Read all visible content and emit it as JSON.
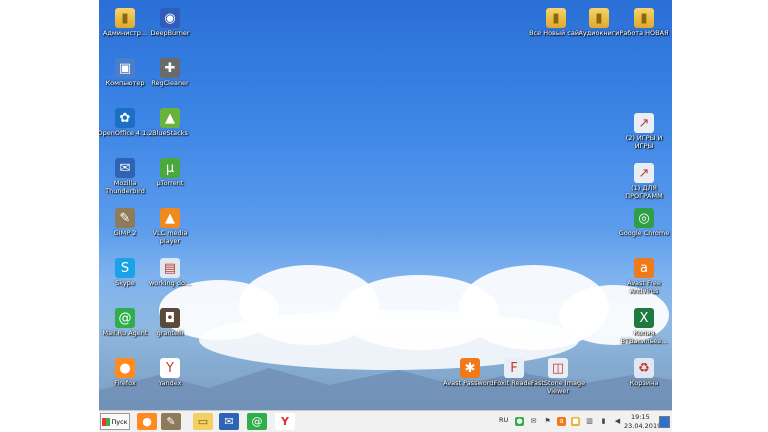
{
  "desktop": {
    "left_icons": [
      {
        "label": "Администр...",
        "icon": "user-folder-icon"
      },
      {
        "label": "DeepBurner",
        "icon": "deepburner-icon"
      },
      {
        "label": "Компьютер",
        "icon": "computer-icon"
      },
      {
        "label": "RegCleaner",
        "icon": "regcleaner-icon"
      },
      {
        "label": "OpenOffice 4.1.2",
        "icon": "openoffice-icon"
      },
      {
        "label": "BlueStacks",
        "icon": "bluestacks-icon"
      },
      {
        "label": "Mozilla Thunderbird",
        "icon": "thunderbird-icon"
      },
      {
        "label": "µTorrent",
        "icon": "utorrent-icon"
      },
      {
        "label": "GIMP 2",
        "icon": "gimp-icon"
      },
      {
        "label": "VLC media player",
        "icon": "vlc-icon"
      },
      {
        "label": "Skype",
        "icon": "skype-icon"
      },
      {
        "label": "working do...",
        "icon": "document-icon"
      },
      {
        "label": "Mail.Ru Agent",
        "icon": "mailru-agent-icon"
      },
      {
        "label": "grantelli",
        "icon": "grantelli-icon"
      },
      {
        "label": "Firefox",
        "icon": "firefox-icon"
      },
      {
        "label": "Yandex",
        "icon": "yandex-browser-icon"
      }
    ],
    "right_icons": [
      {
        "label": "Все Новый сайт",
        "icon": "folder-icon"
      },
      {
        "label": "Аудиокниги",
        "icon": "folder-icon"
      },
      {
        "label": "Работа НОВАЯ",
        "icon": "folder-icon"
      },
      {
        "label": "(2) ИГРЫ И ИГРЫ",
        "icon": "shortcut-icon"
      },
      {
        "label": "(1) ДЛЯ ПРОГРАММ",
        "icon": "shortcut-icon"
      },
      {
        "label": "Google Chrome",
        "icon": "chrome-icon"
      },
      {
        "label": "Avast Free Antivirus",
        "icon": "avast-icon"
      },
      {
        "label": "Копия ВТВасильев...",
        "icon": "excel-icon"
      },
      {
        "label": "Корзина",
        "icon": "recycle-bin-icon"
      }
    ],
    "bottom_icons": [
      {
        "label": "Avast Passwords",
        "icon": "avast-passwords-icon"
      },
      {
        "label": "Foxit Reader",
        "icon": "foxit-reader-icon"
      },
      {
        "label": "FastStone Image Viewer",
        "icon": "faststone-icon"
      }
    ]
  },
  "taskbar": {
    "start_label": "Пуск",
    "apps": [
      "firefox-icon",
      "gimp-icon",
      "explorer-folder-icon",
      "thunderbird-icon",
      "mailru-agent-icon",
      "yandex-browser-icon"
    ],
    "language": "RU",
    "time": "19:15",
    "date": "23.04.2019"
  }
}
